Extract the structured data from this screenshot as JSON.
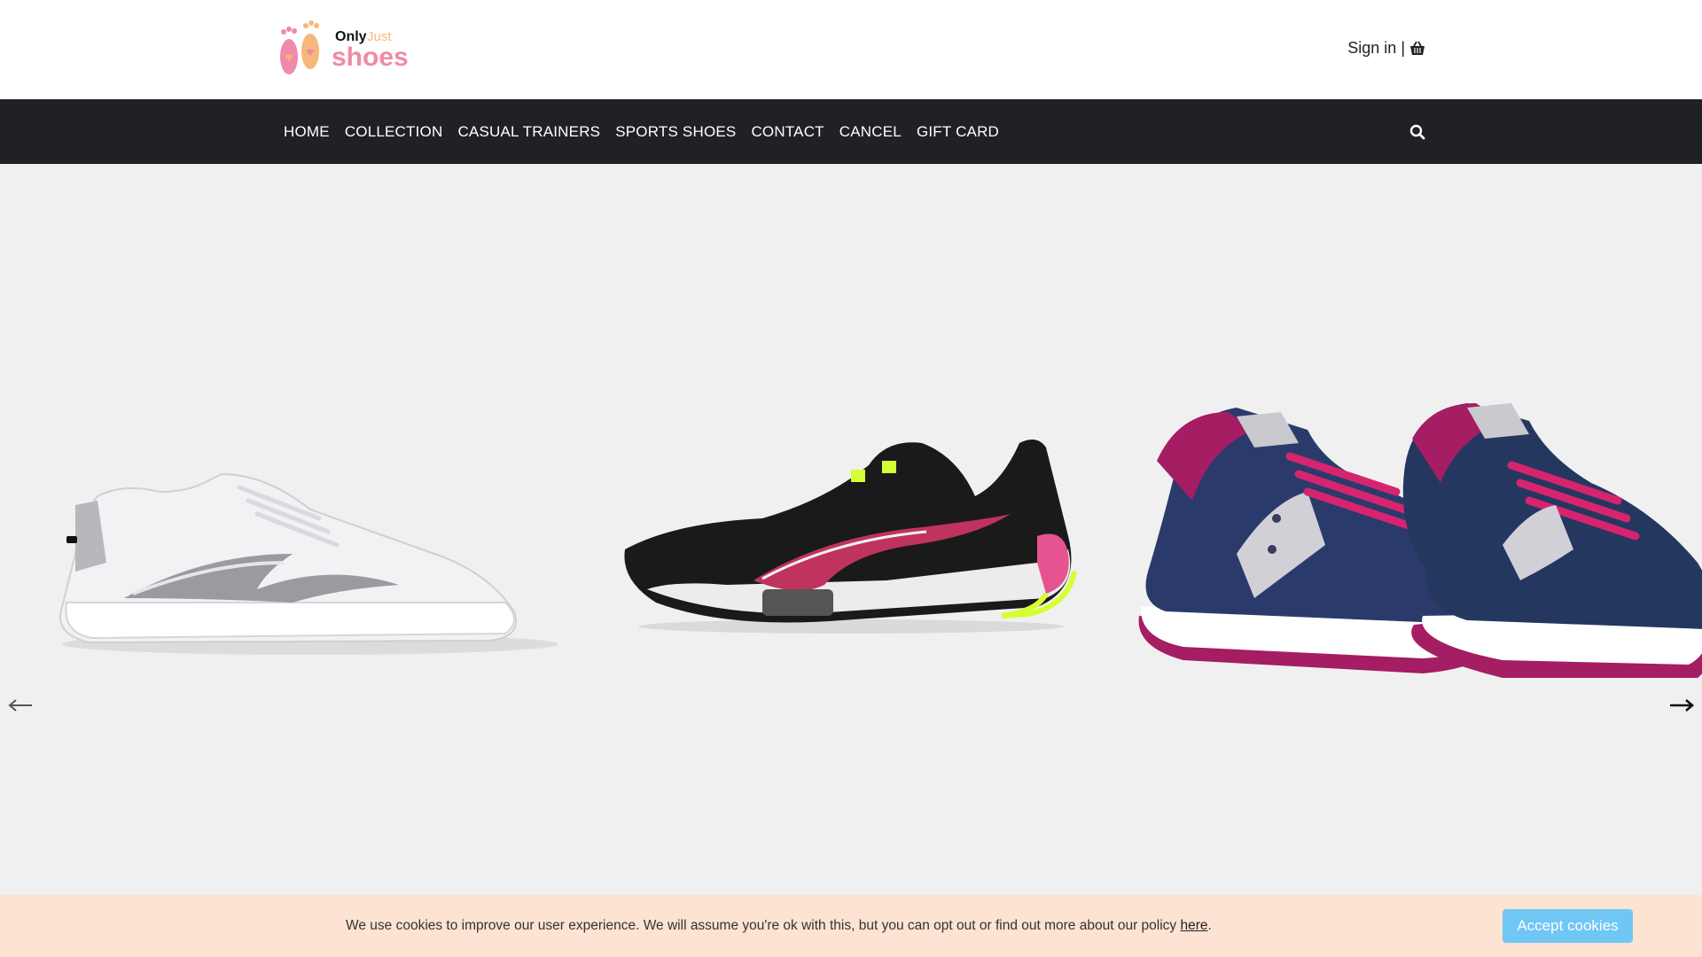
{
  "brand": {
    "logo_word_only": "Only",
    "logo_word_just": "Just",
    "logo_word_shoes": "shoes",
    "colors": {
      "pink": "#f08aa6",
      "peach": "#f7b77a",
      "dark": "#111111"
    }
  },
  "header": {
    "sign_in": "Sign in",
    "separator": "|",
    "cart_icon": "basket-icon"
  },
  "nav": {
    "items": [
      "HOME",
      "COLLECTION",
      "CASUAL TRAINERS",
      "SPORTS SHOES",
      "CONTACT",
      "CANCEL",
      "GIFT CARD"
    ],
    "search_icon": "search-icon",
    "background": "#202127"
  },
  "hero": {
    "slides": [
      {
        "name": "white-silver-trainer"
      },
      {
        "name": "black-pink-sports-shoe"
      },
      {
        "name": "navy-pink-retro-sneaker"
      }
    ],
    "prev_icon": "arrow-left-icon",
    "next_icon": "arrow-right-icon"
  },
  "cookie": {
    "message": "We use cookies to improve our user experience. We will assume you're ok with this, but you can opt out or find out more about our policy ",
    "link_text": "here",
    "trailing": ".",
    "accept_label": "Accept cookies",
    "button_color": "#70c6f5"
  }
}
